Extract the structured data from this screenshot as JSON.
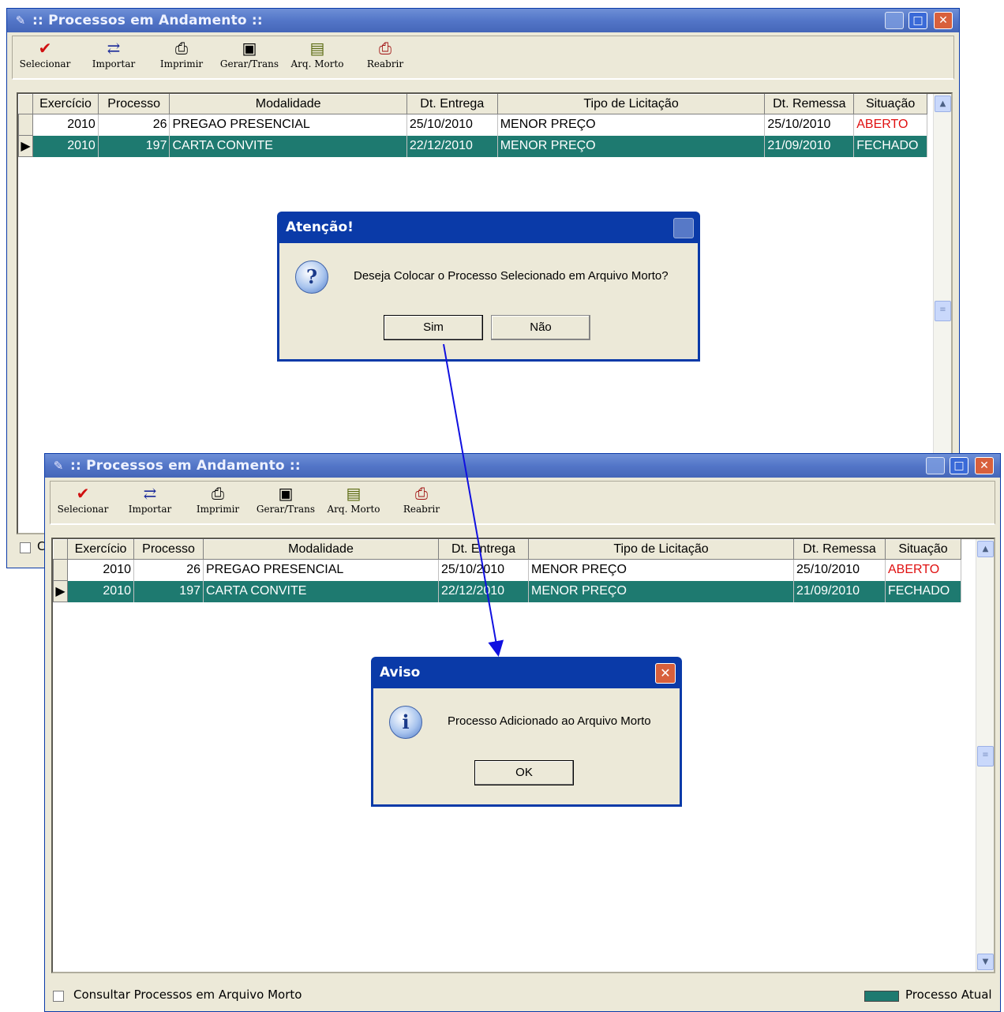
{
  "window": {
    "title": ":: Processos em Andamento ::",
    "minimize": "_",
    "maximize": "□",
    "close": "✕"
  },
  "toolbar": {
    "items": [
      {
        "label": "Selecionar",
        "icon": "checkmark-icon",
        "glyph": "✔",
        "color": "#d01010"
      },
      {
        "label": "Importar",
        "icon": "import-icon",
        "glyph": "⇄",
        "color": "#1a2a9a"
      },
      {
        "label": "Imprimir",
        "icon": "printer-icon",
        "glyph": "🖶",
        "color": "#222222"
      },
      {
        "label": "Gerar/Trans",
        "icon": "floppy-disk-icon",
        "glyph": "💾",
        "color": "#111111"
      },
      {
        "label": "Arq. Morto",
        "icon": "file-archive-icon",
        "glyph": "🗄",
        "color": "#5a6a10"
      },
      {
        "label": "Reabrir",
        "icon": "reopen-printer-icon",
        "glyph": "⎙",
        "color": "#a01010"
      }
    ]
  },
  "grid": {
    "columns": [
      "Exercício",
      "Processo",
      "Modalidade",
      "Dt. Entrega",
      "Tipo de Licitação",
      "Dt. Remessa",
      "Situação"
    ],
    "rows": [
      {
        "exercicio": "2010",
        "processo": "26",
        "modalidade": "PREGAO PRESENCIAL",
        "dt_entrega": "25/10/2010",
        "tipo": "MENOR PREÇO",
        "dt_remessa": "25/10/2010",
        "situacao": "ABERTO"
      },
      {
        "exercicio": "2010",
        "processo": "197",
        "modalidade": "CARTA CONVITE",
        "dt_entrega": "22/12/2010",
        "tipo": "MENOR PREÇO",
        "dt_remessa": "21/09/2010",
        "situacao": "FECHADO"
      }
    ]
  },
  "dialog_confirm": {
    "title": "Atenção!",
    "message": "Deseja Colocar o Processo Selecionado em Arquivo Morto?",
    "yes": "Sim",
    "no": "Não",
    "icon": "question-icon",
    "glyph": "?"
  },
  "dialog_notice": {
    "title": "Aviso",
    "message": "Processo Adicionado ao Arquivo Morto",
    "ok": "OK",
    "icon": "info-icon",
    "glyph": "i"
  },
  "footer": {
    "checkbox_label": "Consultar Processos em Arquivo Morto",
    "legend_label": "Processo Atual",
    "hidden_first_letter": "C"
  },
  "colors": {
    "selected_row": "#1e7a70",
    "aberto": "#e01010",
    "arrow": "#1010e0"
  }
}
